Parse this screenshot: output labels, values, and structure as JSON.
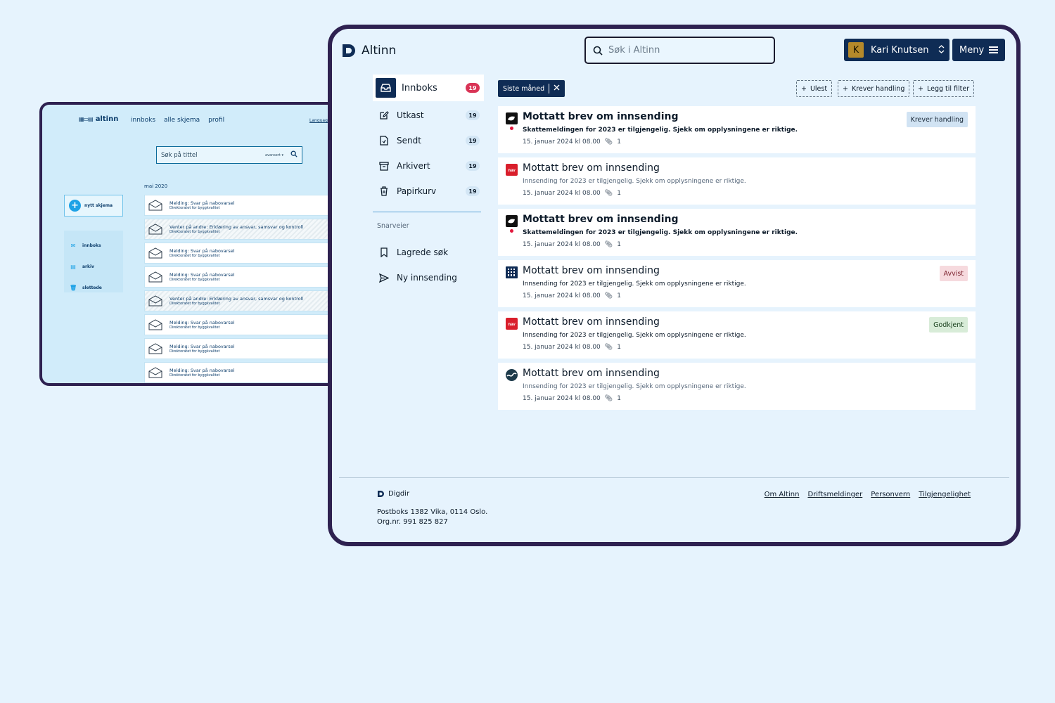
{
  "old_app": {
    "logo": "altinn",
    "nav": [
      "innboks",
      "alle skjema",
      "profil"
    ],
    "language": "Language",
    "search_placeholder": "Søk på tittel",
    "search_advanced": "avansert ▾",
    "month": "mai 2020",
    "new_form": "nytt skjema",
    "sidebar": [
      "innboks",
      "arkiv",
      "slettede"
    ],
    "rows": [
      {
        "title": "Melding: Svar på nabovarsel",
        "sub": "Direktoratet for byggkvalitet",
        "hatch": false
      },
      {
        "title": "Venter på andre: Erklæring av ansvar, samsvar og kontroll",
        "sub": "Direktoratet for byggkvalitet",
        "hatch": true
      },
      {
        "title": "Melding: Svar på nabovarsel",
        "sub": "Direktoratet for byggkvalitet",
        "hatch": false
      },
      {
        "title": "Melding: Svar på nabovarsel",
        "sub": "Direktoratet for byggkvalitet",
        "hatch": false
      },
      {
        "title": "Venter på andre: Erklæring av ansvar, samsvar og kontroll",
        "sub": "Direktoratet for byggkvalitet",
        "hatch": true
      },
      {
        "title": "Melding: Svar på nabovarsel",
        "sub": "Direktoratet for byggkvalitet",
        "hatch": false
      },
      {
        "title": "Melding: Svar på nabovarsel",
        "sub": "Direktoratet for byggkvalitet",
        "hatch": false
      },
      {
        "title": "Melding: Svar på nabovarsel",
        "sub": "Direktoratet for byggkvalitet",
        "hatch": false
      }
    ]
  },
  "header": {
    "brand": "Altinn",
    "search_placeholder": "Søk i Altinn",
    "user_initial": "K",
    "user_name": "Kari Knutsen",
    "menu_label": "Meny"
  },
  "sidebar": {
    "items": [
      {
        "label": "Innboks",
        "count": "19",
        "icon": "inbox-icon",
        "active": true
      },
      {
        "label": "Utkast",
        "count": "19",
        "icon": "draft-icon"
      },
      {
        "label": "Sendt",
        "count": "19",
        "icon": "sent-file-icon"
      },
      {
        "label": "Arkivert",
        "count": "19",
        "icon": "archive-icon"
      },
      {
        "label": "Papirkurv",
        "count": "19",
        "icon": "trash-icon"
      }
    ],
    "shortcuts_title": "Snarveier",
    "shortcuts": [
      {
        "label": "Lagrede søk",
        "icon": "bookmark-icon"
      },
      {
        "label": "Ny innsending",
        "icon": "send-icon"
      }
    ]
  },
  "filters": {
    "active": "Siste måned",
    "add": [
      "Ulest",
      "Krever handling",
      "Legg til filter"
    ]
  },
  "messages": [
    {
      "title": "Mottatt brev om innsending",
      "summary": "Skattemeldingen for 2023 er tilgjengelig. Sjekk om opplysningene er riktige.",
      "date": "15. januar 2024 kl 08.00",
      "attachments": "1",
      "unread": true,
      "badge": "Krever handling",
      "badge_type": "info",
      "logo": "skatteetaten-logo"
    },
    {
      "title": "Mottatt brev om innsending",
      "summary": "Innsending for 2023 er tilgjengelig. Sjekk om opplysningene er riktige.",
      "date": "15. januar 2024 kl 08.00",
      "attachments": "1",
      "unread": false,
      "badge": "",
      "badge_type": "",
      "logo": "nav-logo"
    },
    {
      "title": "Mottatt brev om innsending",
      "summary": "Skattemeldingen for 2023 er tilgjengelig. Sjekk om opplysningene er riktige.",
      "date": "15. januar 2024 kl 08.00",
      "attachments": "1",
      "unread": true,
      "badge": "",
      "badge_type": "",
      "logo": "skatteetaten-logo"
    },
    {
      "title": "Mottatt brev om innsending",
      "summary": "Innsending for 2023 er tilgjengelig. Sjekk om opplysningene er riktige.",
      "date": "15. januar 2024 kl 08.00",
      "attachments": "1",
      "unread": false,
      "badge": "Avvist",
      "badge_type": "danger",
      "logo": "brreg-logo"
    },
    {
      "title": "Mottatt brev om innsending",
      "summary": "Innsending for 2023 er tilgjengelig. Sjekk om opplysningene er riktige.",
      "date": "15. januar 2024 kl 08.00",
      "attachments": "1",
      "unread": false,
      "badge": "Godkjent",
      "badge_type": "success",
      "logo": "nav-logo"
    },
    {
      "title": "Mottatt brev om innsending",
      "summary": "Innsending for 2023 er tilgjengelig. Sjekk om opplysningene er riktige.",
      "date": "15. januar 2024 kl 08.00",
      "attachments": "1",
      "unread": false,
      "badge": "",
      "badge_type": "",
      "logo": "wave-logo",
      "read": true
    }
  ],
  "footer": {
    "brand": "Digdir",
    "address_line1": "Postboks 1382 Vika, 0114 Oslo.",
    "address_line2": "Org.nr. 991 825 827",
    "links": [
      "Om Altinn",
      "Driftsmeldinger",
      "Personvern",
      "Tilgjengelighet"
    ]
  },
  "colors": {
    "primary": "#0f2c55",
    "background": "#e6f3fd",
    "frame": "#2e2150",
    "unread": "#e2183d",
    "nav_red": "#d91e2b",
    "avatar": "#b5892a"
  }
}
